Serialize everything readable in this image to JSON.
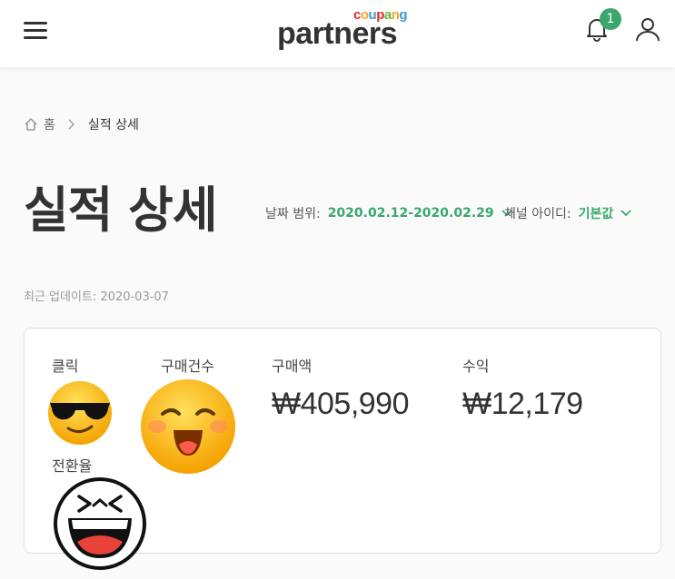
{
  "header": {
    "logo_small": "coupang",
    "logo_main": "partners",
    "notification_count": "1"
  },
  "breadcrumb": {
    "home": "홈",
    "current": "실적 상세"
  },
  "page": {
    "title": "실적 상세",
    "updated": "최근 업데이트: 2020-03-07"
  },
  "filters": {
    "date_label": "날짜 범위:",
    "date_value": "2020.02.12-2020.02.29",
    "channel_label": "채널 아이디:",
    "channel_value": "기본값"
  },
  "metrics": {
    "clicks_label": "클릭",
    "orders_label": "구매건수",
    "sales_label": "구매액",
    "sales_value": "₩405,990",
    "revenue_label": "수익",
    "revenue_value": "₩12,179",
    "conversion_label": "전환율"
  },
  "colors": {
    "accent": "#3aa76d",
    "logo_c": "#e52528",
    "logo_o": "#f5a623",
    "logo_u": "#3d9ad6",
    "logo_p": "#e52528",
    "logo_a": "#5fb946",
    "logo_n": "#f5a623",
    "logo_g": "#3d9ad6"
  },
  "icons": {
    "menu": "hamburger-icon",
    "notifications": "bell-icon",
    "profile": "user-icon",
    "home": "home-icon"
  }
}
